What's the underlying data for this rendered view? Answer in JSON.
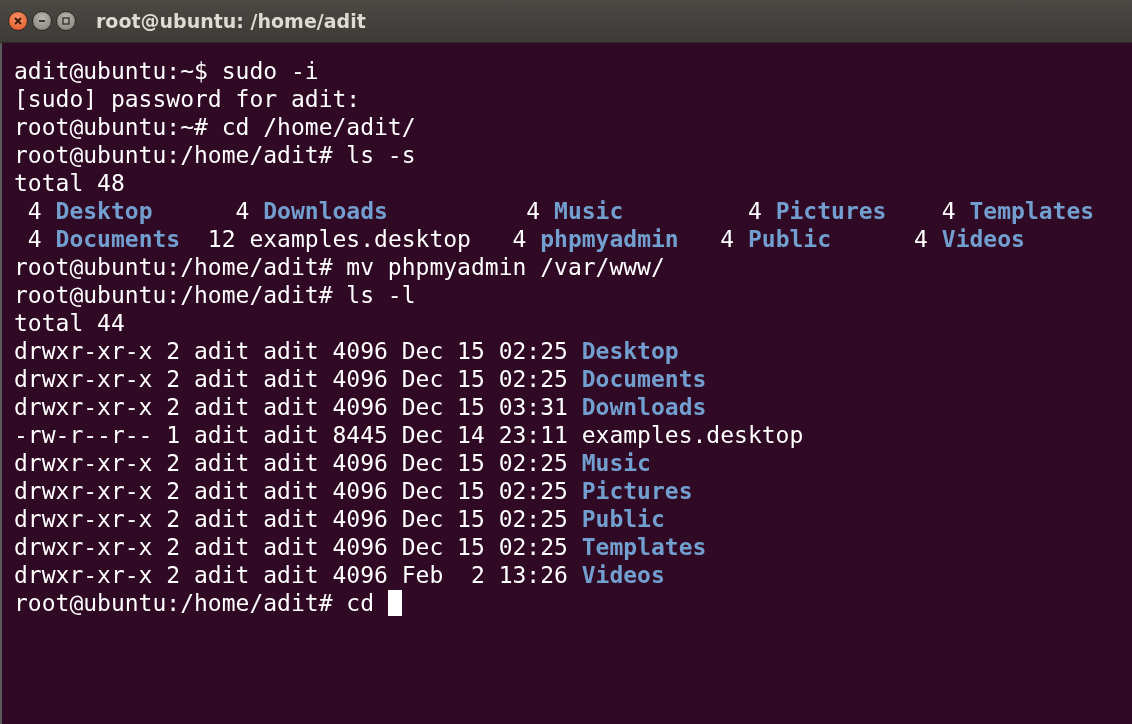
{
  "window": {
    "title": "root@ubuntu: /home/adit"
  },
  "terminal": {
    "lines": [
      {
        "cursor": false,
        "segments": [
          {
            "kind": "plain",
            "text": "adit@ubuntu:~$ sudo -i"
          }
        ]
      },
      {
        "cursor": false,
        "segments": [
          {
            "kind": "plain",
            "text": "[sudo] password for adit:"
          }
        ]
      },
      {
        "cursor": false,
        "segments": [
          {
            "kind": "plain",
            "text": "root@ubuntu:~# cd /home/adit/"
          }
        ]
      },
      {
        "cursor": false,
        "segments": [
          {
            "kind": "plain",
            "text": "root@ubuntu:/home/adit# ls -s"
          }
        ]
      },
      {
        "cursor": false,
        "segments": [
          {
            "kind": "plain",
            "text": "total 48"
          }
        ]
      },
      {
        "cursor": false,
        "segments": [
          {
            "kind": "plain",
            "text": " 4 "
          },
          {
            "kind": "dir",
            "text": "Desktop"
          },
          {
            "kind": "plain",
            "text": "      4 "
          },
          {
            "kind": "dir",
            "text": "Downloads"
          },
          {
            "kind": "plain",
            "text": "          4 "
          },
          {
            "kind": "dir",
            "text": "Music"
          },
          {
            "kind": "plain",
            "text": "         4 "
          },
          {
            "kind": "dir",
            "text": "Pictures"
          },
          {
            "kind": "plain",
            "text": "    4 "
          },
          {
            "kind": "dir",
            "text": "Templates"
          }
        ]
      },
      {
        "cursor": false,
        "segments": [
          {
            "kind": "plain",
            "text": " 4 "
          },
          {
            "kind": "dir",
            "text": "Documents"
          },
          {
            "kind": "plain",
            "text": "  12 examples.desktop   4 "
          },
          {
            "kind": "dir",
            "text": "phpmyadmin"
          },
          {
            "kind": "plain",
            "text": "   4 "
          },
          {
            "kind": "dir",
            "text": "Public"
          },
          {
            "kind": "plain",
            "text": "      4 "
          },
          {
            "kind": "dir",
            "text": "Videos"
          }
        ]
      },
      {
        "cursor": false,
        "segments": [
          {
            "kind": "plain",
            "text": "root@ubuntu:/home/adit# mv phpmyadmin /var/www/"
          }
        ]
      },
      {
        "cursor": false,
        "segments": [
          {
            "kind": "plain",
            "text": "root@ubuntu:/home/adit# ls -l"
          }
        ]
      },
      {
        "cursor": false,
        "segments": [
          {
            "kind": "plain",
            "text": "total 44"
          }
        ]
      },
      {
        "cursor": false,
        "segments": [
          {
            "kind": "plain",
            "text": "drwxr-xr-x 2 adit adit 4096 Dec 15 02:25 "
          },
          {
            "kind": "dir",
            "text": "Desktop"
          }
        ]
      },
      {
        "cursor": false,
        "segments": [
          {
            "kind": "plain",
            "text": "drwxr-xr-x 2 adit adit 4096 Dec 15 02:25 "
          },
          {
            "kind": "dir",
            "text": "Documents"
          }
        ]
      },
      {
        "cursor": false,
        "segments": [
          {
            "kind": "plain",
            "text": "drwxr-xr-x 2 adit adit 4096 Dec 15 03:31 "
          },
          {
            "kind": "dir",
            "text": "Downloads"
          }
        ]
      },
      {
        "cursor": false,
        "segments": [
          {
            "kind": "plain",
            "text": "-rw-r--r-- 1 adit adit 8445 Dec 14 23:11 examples.desktop"
          }
        ]
      },
      {
        "cursor": false,
        "segments": [
          {
            "kind": "plain",
            "text": "drwxr-xr-x 2 adit adit 4096 Dec 15 02:25 "
          },
          {
            "kind": "dir",
            "text": "Music"
          }
        ]
      },
      {
        "cursor": false,
        "segments": [
          {
            "kind": "plain",
            "text": "drwxr-xr-x 2 adit adit 4096 Dec 15 02:25 "
          },
          {
            "kind": "dir",
            "text": "Pictures"
          }
        ]
      },
      {
        "cursor": false,
        "segments": [
          {
            "kind": "plain",
            "text": "drwxr-xr-x 2 adit adit 4096 Dec 15 02:25 "
          },
          {
            "kind": "dir",
            "text": "Public"
          }
        ]
      },
      {
        "cursor": false,
        "segments": [
          {
            "kind": "plain",
            "text": "drwxr-xr-x 2 adit adit 4096 Dec 15 02:25 "
          },
          {
            "kind": "dir",
            "text": "Templates"
          }
        ]
      },
      {
        "cursor": false,
        "segments": [
          {
            "kind": "plain",
            "text": "drwxr-xr-x 2 adit adit 4096 Feb  2 13:26 "
          },
          {
            "kind": "dir",
            "text": "Videos"
          }
        ]
      },
      {
        "cursor": true,
        "segments": [
          {
            "kind": "plain",
            "text": "root@ubuntu:/home/adit# cd "
          }
        ]
      }
    ]
  }
}
